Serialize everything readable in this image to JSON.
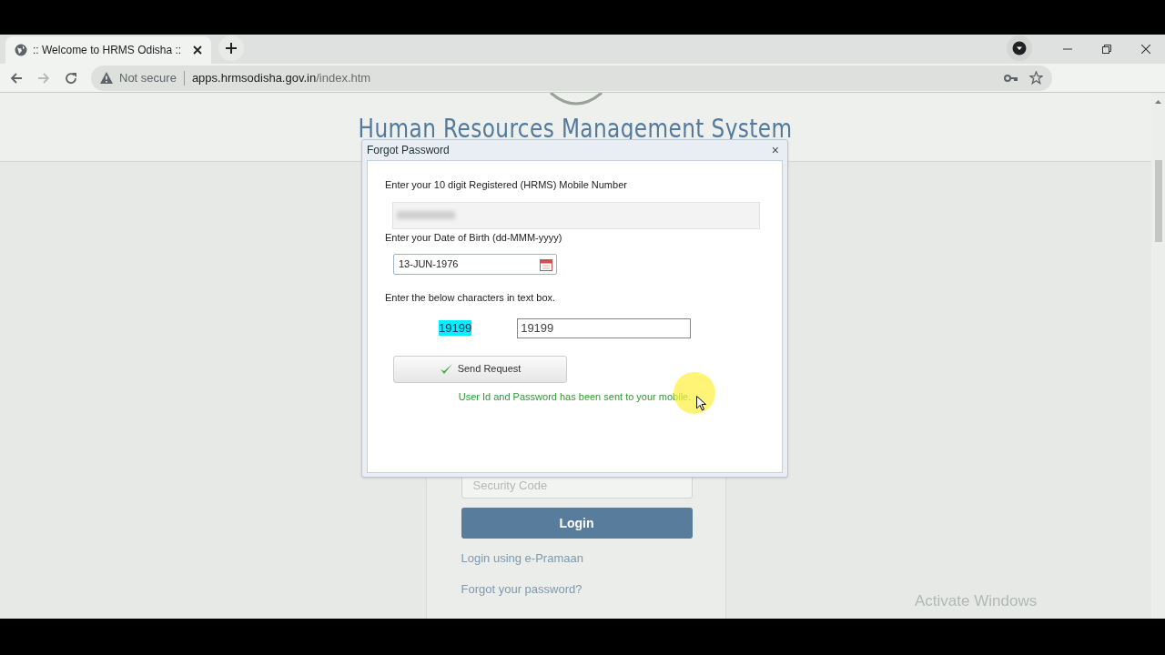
{
  "browser": {
    "tab": {
      "title": ":: Welcome to HRMS Odisha ::"
    },
    "address": {
      "security": "Not secure",
      "url_host": "apps.hrmsodisha.gov.in",
      "url_path": "/index.htm"
    }
  },
  "page": {
    "heading": "Human Resources Management System",
    "login": {
      "security_code_placeholder": "Security Code",
      "login_button": "Login",
      "links": [
        "Login using e-Pramaan",
        "Forgot your password?"
      ]
    }
  },
  "dialog": {
    "title": "Forgot Password",
    "close": "×",
    "mobile_label": "Enter your 10 digit Registered (HRMS) Mobile Number",
    "dob_label": "Enter your Date of Birth (dd-MMM-yyyy)",
    "dob_value": "13-JUN-1976",
    "captcha_label": "Enter the below characters in text box.",
    "captcha": "19199",
    "captcha_value": "19199",
    "send_button": "Send Request",
    "message": "User Id and Password has been sent to your mobile."
  },
  "system": {
    "activation_notice": "Activate Windows"
  }
}
